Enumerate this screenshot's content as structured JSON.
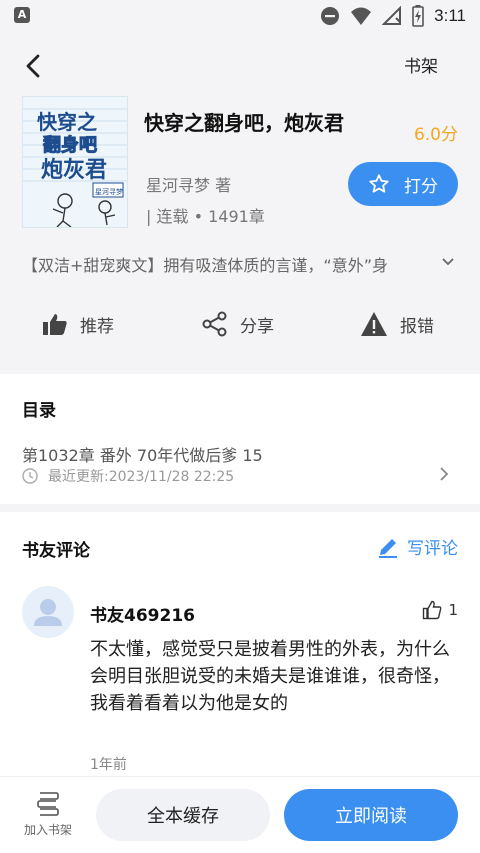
{
  "status_bar": {
    "time": "3:11",
    "left_icon_label": "A",
    "icons": [
      "notification-icon",
      "do-not-disturb-icon",
      "wifi-icon",
      "no-signal-icon",
      "battery-charging-icon"
    ]
  },
  "nav": {
    "back_icon": "back-arrow-icon",
    "shelf_label": "书架"
  },
  "book": {
    "title": "快穿之翻身吧，炮灰君",
    "score": "6.0分",
    "author": "星河寻梦 著",
    "status": "| 连载 • 1491章",
    "rate_label": "打分",
    "rate_icon": "star-outline-icon",
    "intro": "【双洁+甜宠爽文】拥有吸渣体质的言谨，“意外”身",
    "cover_title_lines": [
      "快穿之",
      "翻身吧",
      "炮灰君"
    ],
    "cover_badge": "星河寻梦"
  },
  "actions": [
    {
      "label": "推荐",
      "icon": "thumbs-up-icon"
    },
    {
      "label": "分享",
      "icon": "share-icon"
    },
    {
      "label": "报错",
      "icon": "warning-icon"
    }
  ],
  "catalog": {
    "title": "目录",
    "latest_chapter": "第1032章 番外 70年代做后爹 15",
    "update_time": "最近更新:2023/11/28 22:25"
  },
  "comments": {
    "title": "书友评论",
    "write_label": "写评论",
    "items": [
      {
        "user": "书友469216",
        "likes": "1",
        "text": "不太懂，感觉受只是披着男性的外表，为什么会明目张胆说受的未婚夫是谁谁谁，很奇怪，我看着看着以为他是女的",
        "time": "1年前"
      }
    ]
  },
  "bottom_bar": {
    "add_shelf_label": "加入书架",
    "cache_label": "全本缓存",
    "read_label": "立即阅读"
  },
  "colors": {
    "accent": "#3a8ff0",
    "score": "#f5a623",
    "background": "#f4f4f6"
  }
}
